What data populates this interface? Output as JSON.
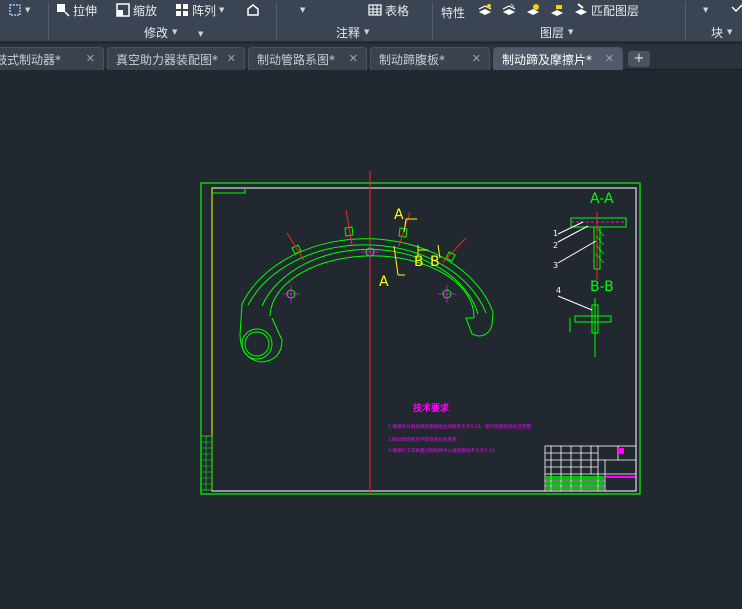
{
  "ribbon": {
    "tools": {
      "stretch": "拉伸",
      "scale": "缩放",
      "array": "阵列",
      "table": "表格",
      "properties": "特性",
      "match_layer": "匹配图层"
    },
    "panels": {
      "modify": "修改",
      "annotation": "注释",
      "layers": "图层",
      "block": "块"
    }
  },
  "tabs": [
    {
      "label": "鼓式制动器*"
    },
    {
      "label": "真空助力器装配图*"
    },
    {
      "label": "制动管路系图*"
    },
    {
      "label": "制动蹄腹板*"
    },
    {
      "label": "制动蹄及摩擦片*"
    }
  ],
  "drawing": {
    "section_aa": "A-A",
    "section_bb": "B-B",
    "label_a": "A",
    "label_b": "B",
    "callouts": [
      "1",
      "2",
      "3",
      "4"
    ],
    "notes_title": "技术要求",
    "notes": [
      "1.摩擦片与制动蹄的铆接贴合间隙不大于0.25，铆钉装配后铆头应完整",
      "2.制动蹄焊接后不得有裂纹及变形",
      "3.摩擦片工作表面对制动蹄中心线的跳动不大于0.10"
    ]
  },
  "colors": {
    "background": "#212830",
    "ribbon": "#3b4453",
    "drawing_green": "#00ff00",
    "drawing_white": "#ffffff",
    "drawing_yellow": "#ffff00",
    "drawing_red": "#ff2020",
    "drawing_magenta": "#ff00ff"
  }
}
